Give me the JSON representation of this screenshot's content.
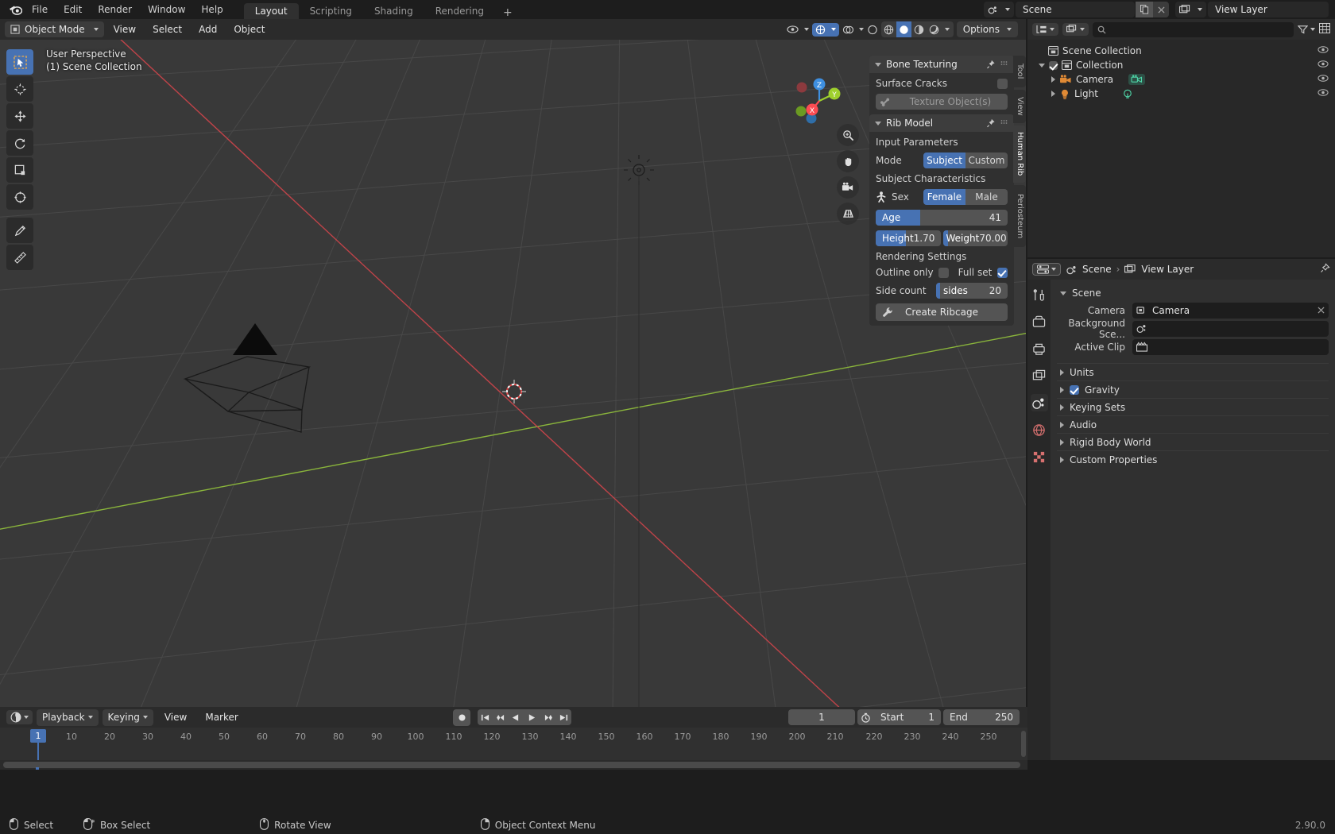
{
  "app": {
    "version": "2.90.0"
  },
  "topbar": {
    "logo_icon": "blender-logo-icon",
    "menus": [
      "File",
      "Edit",
      "Render",
      "Window",
      "Help"
    ],
    "workspaces": [
      {
        "label": "Layout",
        "active": true
      },
      {
        "label": "Scripting",
        "active": false
      },
      {
        "label": "Shading",
        "active": false
      },
      {
        "label": "Rendering",
        "active": false
      }
    ],
    "add_workspace": "+",
    "scene_icon": "scene-icon",
    "scene_name": "Scene",
    "copy_icon": "duplicate-icon",
    "close_icon": "x-icon",
    "viewlayer_icon": "view-layer-icon",
    "viewlayer_name": "View Layer"
  },
  "viewport": {
    "mode_icon": "object-mode-icon",
    "mode": "Object Mode",
    "menus": [
      "View",
      "Select",
      "Add",
      "Object"
    ],
    "options_label": "Options",
    "overlay_icons": [
      "visibility-icon",
      "gizmo-icon",
      "overlays-icon",
      "xray-icon",
      "shading-icon"
    ],
    "shading_modes": [
      "wireframe-icon",
      "solid-icon",
      "material-icon",
      "rendered-icon"
    ],
    "shading_active_index": 1,
    "header_text_line1": "User Perspective",
    "header_text_line2": "(1) Scene Collection",
    "toolbar_icons": [
      "tweak-select-icon",
      "cursor-icon",
      "move-icon",
      "rotate-icon",
      "scale-icon",
      "transform-icon",
      "annotate-icon",
      "measure-icon"
    ],
    "toolbar_active_index": 0,
    "nav_icons": [
      "zoom-icon",
      "pan-hand-icon",
      "camera-view-icon",
      "ortho-persp-icon"
    ],
    "gizmo_axes": [
      "X",
      "Y",
      "Z"
    ],
    "gizmo_colors": {
      "x": "#fc4c52",
      "y": "#9ecf2d",
      "z": "#3e8fe0"
    },
    "grid_axis_x_color": "#c7444a",
    "grid_axis_y_color": "#8fbc3c"
  },
  "npanel": {
    "tabs": [
      {
        "label": "Tool",
        "active": false
      },
      {
        "label": "View",
        "active": false
      },
      {
        "label": "Human Rib",
        "active": true
      },
      {
        "label": "Periosteum",
        "active": false
      }
    ],
    "panels": [
      {
        "title": "Bone Texturing",
        "pin_icon": "pin-icon",
        "grip_icon": "grip-icon",
        "rows": [
          {
            "kind": "label",
            "text": "Surface Cracks",
            "checkbox": false
          },
          {
            "kind": "objectfield",
            "icon": "bone-icon",
            "placeholder": "Texture Object(s)"
          }
        ]
      },
      {
        "title": "Rib Model",
        "pin_icon": "pin-icon",
        "grip_icon": "grip-icon",
        "section_input": "Input Parameters",
        "mode_label": "Mode",
        "mode_options": [
          "Subject",
          "Custom"
        ],
        "mode_selected": "Subject",
        "section_subject": "Subject Characteristics",
        "sex_icon": "person-icon",
        "sex_label": "Sex",
        "sex_options": [
          "Female",
          "Male"
        ],
        "sex_selected": "Female",
        "age_label": "Age",
        "age_value": "41",
        "age_fill_percent": 34,
        "height_label": "Height",
        "height_value": "1.70",
        "weight_label": "Weight",
        "weight_value": "70.00",
        "section_render": "Rendering Settings",
        "outline_label": "Outline only",
        "outline_checked": false,
        "fullset_label": "Full set",
        "fullset_checked": true,
        "sidecount_label": "Side count",
        "sidecount_name": "sides",
        "sidecount_value": "20",
        "create_icon": "wrench-icon",
        "create_label": "Create Ribcage"
      }
    ]
  },
  "outliner": {
    "display_mode_icon": "outliner-display-icon",
    "filter_icon": "filter-icon",
    "new_collection_icon": "new-collection-icon",
    "search_icon": "search-icon",
    "search_value": "",
    "search_placeholder": "",
    "rows": [
      {
        "indent": 0,
        "icon": "scene-collection-icon",
        "label": "Scene Collection",
        "expand": "none",
        "checkbox": false,
        "eye": true
      },
      {
        "indent": 1,
        "icon": "collection-icon",
        "label": "Collection",
        "expand": "down",
        "checkbox": true,
        "eye": true
      },
      {
        "indent": 2,
        "icon": "camera-obj-icon",
        "label": "Camera",
        "expand": "right",
        "data_icon": "camera-data-icon",
        "eye": true
      },
      {
        "indent": 2,
        "icon": "light-obj-icon",
        "label": "Light",
        "expand": "right",
        "data_icon": "light-data-icon",
        "eye": true
      }
    ]
  },
  "properties": {
    "editor_icon": "properties-editor-icon",
    "breadcrumb": [
      {
        "icon": "scene-icon",
        "label": "Scene"
      },
      {
        "icon": "view-layer-icon",
        "label": "View Layer"
      }
    ],
    "pin_icon": "pin-icon",
    "tabs": [
      "tool-tab-icon",
      "render-tab-icon",
      "output-tab-icon",
      "viewlayer-tab-icon",
      "scene-tab-icon",
      "world-tab-icon",
      "texture-tab-icon"
    ],
    "active_tab_index": 4,
    "section_title": "Scene",
    "fields": [
      {
        "label": "Camera",
        "icon": "camera-obj-icon",
        "value": "Camera",
        "clear_icon": "x-icon"
      },
      {
        "label": "Background Sce...",
        "icon": "scene-icon",
        "value": ""
      },
      {
        "label": "Active Clip",
        "icon": "clip-icon",
        "value": ""
      }
    ],
    "sections": [
      {
        "label": "Units",
        "checkbox": null
      },
      {
        "label": "Gravity",
        "checkbox": true
      },
      {
        "label": "Keying Sets",
        "checkbox": null
      },
      {
        "label": "Audio",
        "checkbox": null
      },
      {
        "label": "Rigid Body World",
        "checkbox": null
      },
      {
        "label": "Custom Properties",
        "checkbox": null
      }
    ]
  },
  "timeline": {
    "editor_icon": "timeline-editor-icon",
    "menus": [
      "Playback",
      "Keying",
      "View",
      "Marker"
    ],
    "record_icon": "record-icon",
    "transport_icons": [
      "jump-start-icon",
      "prev-keyframe-icon",
      "play-reverse-icon",
      "play-icon",
      "next-keyframe-icon",
      "jump-end-icon"
    ],
    "current_frame": "1",
    "clock_icon": "stopwatch-icon",
    "start_label": "Start",
    "start_value": "1",
    "end_label": "End",
    "end_value": "250",
    "ticks": [
      "1",
      "10",
      "20",
      "30",
      "40",
      "50",
      "60",
      "70",
      "80",
      "90",
      "100",
      "110",
      "120",
      "130",
      "140",
      "150",
      "160",
      "170",
      "180",
      "190",
      "200",
      "210",
      "220",
      "230",
      "240",
      "250"
    ],
    "playhead_frame": "1"
  },
  "statusbar": {
    "items": [
      {
        "icon": "mouse-left-icon",
        "label": "Select"
      },
      {
        "icon": "mouse-left-drag-icon",
        "label": "Box Select"
      },
      {
        "icon": "mouse-middle-icon",
        "label": "Rotate View"
      },
      {
        "icon": "mouse-right-icon",
        "label": "Object Context Menu"
      }
    ],
    "version": "2.90.0"
  }
}
